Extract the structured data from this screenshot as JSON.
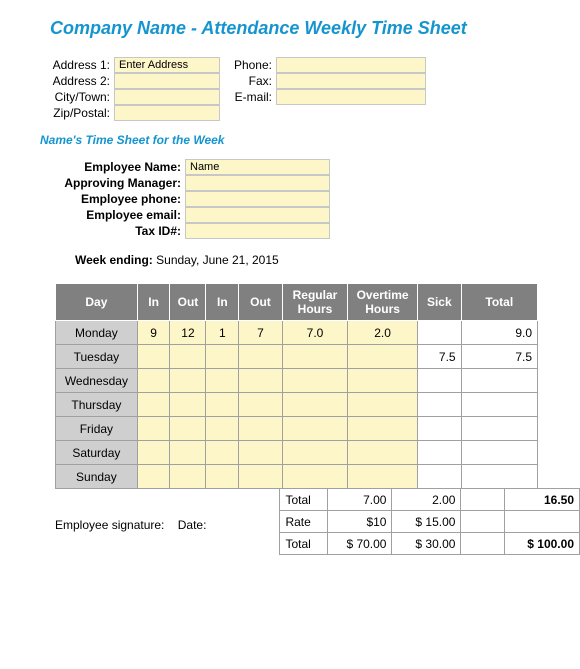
{
  "title": "Company Name - Attendance Weekly Time Sheet",
  "address": {
    "address1_label": "Address 1:",
    "address1_value": "Enter Address",
    "address2_label": "Address 2:",
    "address2_value": "",
    "city_label": "City/Town:",
    "city_value": "",
    "zip_label": "Zip/Postal:",
    "zip_value": "",
    "phone_label": "Phone:",
    "phone_value": "",
    "fax_label": "Fax:",
    "fax_value": "",
    "email_label": "E-mail:",
    "email_value": ""
  },
  "subtitle": "Name's Time Sheet for the Week",
  "employee": {
    "name_label": "Employee Name:",
    "name_value": "Name",
    "manager_label": "Approving Manager:",
    "manager_value": "",
    "phone_label": "Employee phone:",
    "phone_value": "",
    "email_label": "Employee email:",
    "email_value": "",
    "tax_label": "Tax ID#:",
    "tax_value": ""
  },
  "week_ending_label": "Week ending:",
  "week_ending_value": "Sunday, June 21, 2015",
  "headers": {
    "day": "Day",
    "in": "In",
    "out": "Out",
    "in2": "In",
    "out2": "Out",
    "reg": "Regular Hours",
    "ot": "Overtime Hours",
    "sick": "Sick",
    "total": "Total"
  },
  "rows": [
    {
      "day": "Monday",
      "in": "9",
      "out": "12",
      "in2": "1",
      "out2": "7",
      "reg": "7.0",
      "ot": "2.0",
      "sick": "",
      "total": "9.0"
    },
    {
      "day": "Tuesday",
      "in": "",
      "out": "",
      "in2": "",
      "out2": "",
      "reg": "",
      "ot": "",
      "sick": "7.5",
      "total": "7.5"
    },
    {
      "day": "Wednesday",
      "in": "",
      "out": "",
      "in2": "",
      "out2": "",
      "reg": "",
      "ot": "",
      "sick": "",
      "total": ""
    },
    {
      "day": "Thursday",
      "in": "",
      "out": "",
      "in2": "",
      "out2": "",
      "reg": "",
      "ot": "",
      "sick": "",
      "total": ""
    },
    {
      "day": "Friday",
      "in": "",
      "out": "",
      "in2": "",
      "out2": "",
      "reg": "",
      "ot": "",
      "sick": "",
      "total": ""
    },
    {
      "day": "Saturday",
      "in": "",
      "out": "",
      "in2": "",
      "out2": "",
      "reg": "",
      "ot": "",
      "sick": "",
      "total": ""
    },
    {
      "day": "Sunday",
      "in": "",
      "out": "",
      "in2": "",
      "out2": "",
      "reg": "",
      "ot": "",
      "sick": "",
      "total": ""
    }
  ],
  "totals": {
    "total_label": "Total",
    "total_reg": "7.00",
    "total_ot": "2.00",
    "total_sick": "",
    "total_total": "16.50",
    "rate_label": "Rate",
    "rate_reg": "$10",
    "rate_ot": "$    15.00",
    "grand_label": "Total",
    "grand_reg": "$  70.00",
    "grand_ot": "$    30.00",
    "grand_total": "$   100.00"
  },
  "signature_label": "Employee signature:",
  "date_label": "Date:",
  "chart_data": {
    "type": "table",
    "title": "Attendance Weekly Time Sheet",
    "columns": [
      "Day",
      "In",
      "Out",
      "In",
      "Out",
      "Regular Hours",
      "Overtime Hours",
      "Sick",
      "Total"
    ],
    "rows": [
      [
        "Monday",
        9,
        12,
        1,
        7,
        7.0,
        2.0,
        null,
        9.0
      ],
      [
        "Tuesday",
        null,
        null,
        null,
        null,
        null,
        null,
        7.5,
        7.5
      ],
      [
        "Wednesday",
        null,
        null,
        null,
        null,
        null,
        null,
        null,
        null
      ],
      [
        "Thursday",
        null,
        null,
        null,
        null,
        null,
        null,
        null,
        null
      ],
      [
        "Friday",
        null,
        null,
        null,
        null,
        null,
        null,
        null,
        null
      ],
      [
        "Saturday",
        null,
        null,
        null,
        null,
        null,
        null,
        null,
        null
      ],
      [
        "Sunday",
        null,
        null,
        null,
        null,
        null,
        null,
        null,
        null
      ]
    ],
    "summary": {
      "total_regular_hours": 7.0,
      "total_overtime_hours": 2.0,
      "total_hours": 16.5,
      "rate_regular": 10,
      "rate_overtime": 15.0,
      "pay_regular": 70.0,
      "pay_overtime": 30.0,
      "pay_total": 100.0
    }
  }
}
